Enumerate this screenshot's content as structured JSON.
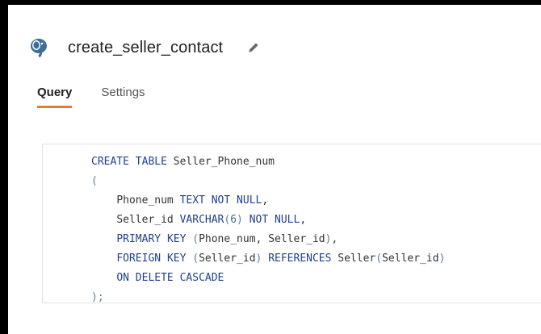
{
  "header": {
    "title": "create_seller_contact",
    "db_icon": "postgresql-elephant-icon",
    "edit_icon": "pencil-icon"
  },
  "tabs": [
    {
      "label": "Query",
      "active": true
    },
    {
      "label": "Settings",
      "active": false
    }
  ],
  "query": {
    "lines": [
      "CREATE TABLE Seller_Phone_num",
      "(",
      "    Phone_num TEXT NOT NULL,",
      "    Seller_id VARCHAR(6) NOT NULL,",
      "    PRIMARY KEY (Phone_num, Seller_id),",
      "    FOREIGN KEY (Seller_id) REFERENCES Seller(Seller_id)",
      "    ON DELETE CASCADE",
      ");"
    ]
  },
  "colors": {
    "accent_underline": "#e07b39",
    "keyword": "#1f3f8f"
  }
}
